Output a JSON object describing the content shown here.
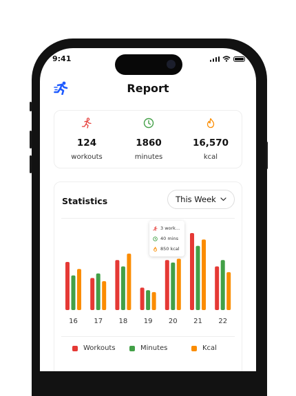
{
  "status": {
    "time": "9:41"
  },
  "header": {
    "title": "Report",
    "logo_icon": "running-figure-icon"
  },
  "summary": [
    {
      "icon": "running-icon",
      "value": "124",
      "label": "workouts",
      "color": "#e53935"
    },
    {
      "icon": "clock-icon",
      "value": "1860",
      "label": "minutes",
      "color": "#43a047"
    },
    {
      "icon": "flame-icon",
      "value": "16,570",
      "label": "kcal",
      "color": "#fb8c00"
    }
  ],
  "statistics": {
    "title": "Statistics",
    "period_label": "This Week",
    "tooltip": {
      "workouts": "3 work...",
      "minutes": "40 mins",
      "kcal": "850 kcal"
    },
    "legend": [
      {
        "name": "Workouts",
        "color": "#e53935"
      },
      {
        "name": "Minutes",
        "color": "#43a047"
      },
      {
        "name": "Kcal",
        "color": "#fb8c00"
      }
    ]
  },
  "chart_data": {
    "type": "bar",
    "categories": [
      "16",
      "17",
      "18",
      "19",
      "20",
      "21",
      "22"
    ],
    "series": [
      {
        "name": "Workouts",
        "values": [
          75,
          50,
          78,
          35,
          78,
          120,
          68
        ]
      },
      {
        "name": "Minutes",
        "values": [
          54,
          57,
          68,
          31,
          74,
          100,
          78
        ]
      },
      {
        "name": "Kcal",
        "values": [
          64,
          45,
          88,
          28,
          80,
          110,
          59
        ]
      }
    ],
    "ylim": [
      0,
      135
    ],
    "grid": false
  }
}
